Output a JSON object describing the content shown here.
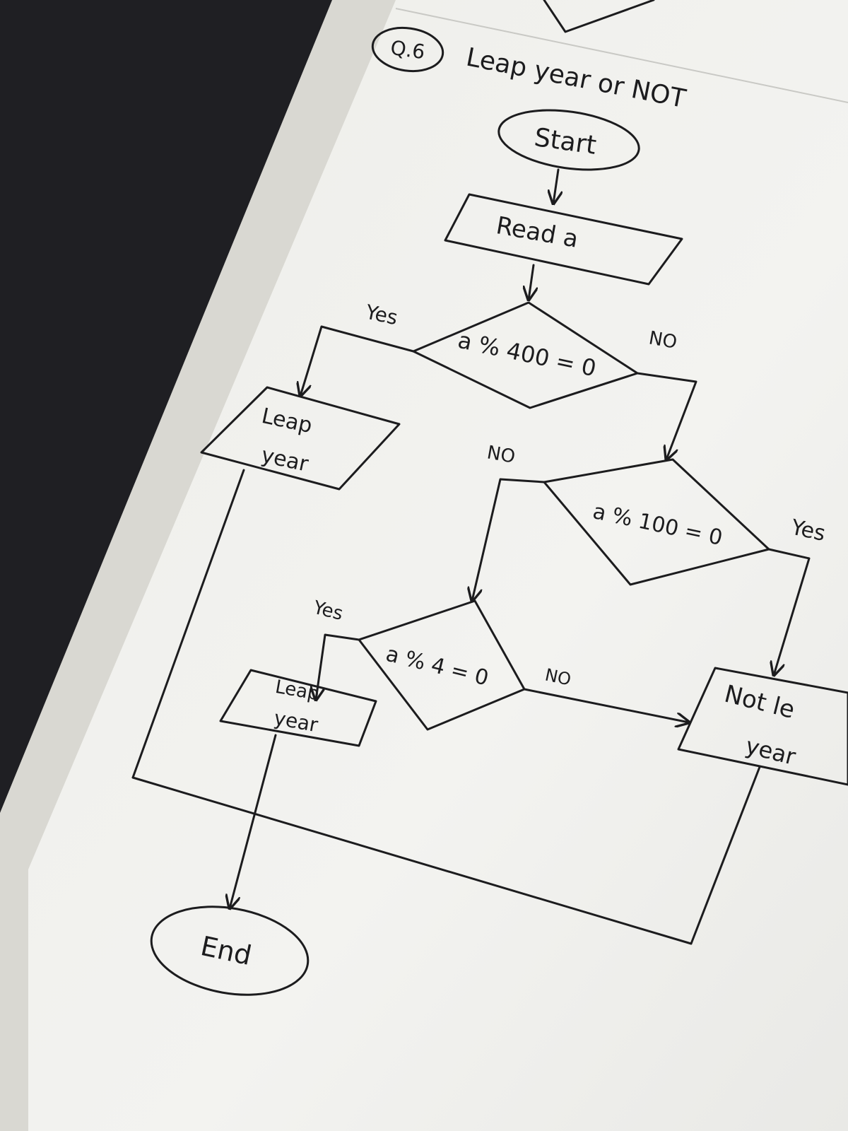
{
  "diagram": {
    "question_number": "Q.6",
    "title": "Leap year or NOT",
    "nodes": {
      "start": "Start",
      "input": "Read a",
      "decision_400": "a % 400 = 0",
      "decision_100": "a % 100 = 0",
      "decision_4": "a % 4 = 0",
      "output_leap_1_line1": "Leap",
      "output_leap_1_line2": "year",
      "output_leap_2_line1": "Leap",
      "output_leap_2_line2": "year",
      "output_not_leap_line1": "Not le",
      "output_not_leap_line2": "year",
      "end": "End"
    },
    "edge_labels": {
      "d400_yes": "Yes",
      "d400_no": "NO",
      "d100_no": "NO",
      "d100_yes": "Yes",
      "d4_yes": "Yes",
      "d4_no": "NO"
    }
  },
  "colors": {
    "background": "#1f1f23",
    "paper": "#f1f0ec",
    "ink": "#1c1c1e"
  }
}
